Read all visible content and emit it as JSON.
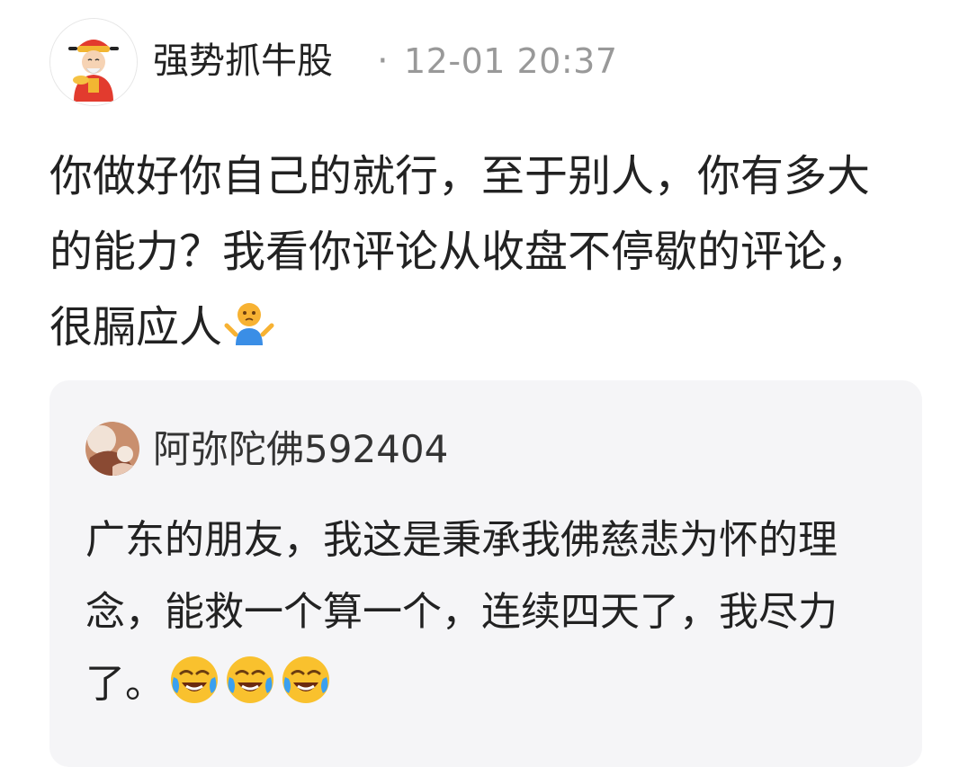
{
  "post": {
    "author": {
      "name": "强势抓牛股",
      "avatar_icon": "caishen-avatar-icon"
    },
    "separator": "·",
    "timestamp": "12-01 20:37",
    "content": "你做好你自己的就行，至于别人，你有多大的能力？我看你评论从收盘不停歇的评论，很膈应人",
    "content_emoji": "shrug-emoji-icon"
  },
  "quoted": {
    "author": {
      "name": "阿弥陀佛592404",
      "avatar_icon": "user-avatar-icon"
    },
    "content": "广东的朋友，我这是秉承我佛慈悲为怀的理念，能救一个算一个，连续四天了，我尽力了。",
    "content_emojis": [
      "laugh-cry-emoji-icon",
      "laugh-cry-emoji-icon",
      "laugh-cry-emoji-icon"
    ]
  },
  "colors": {
    "quote_background": "#f5f5f7",
    "timestamp": "#999999",
    "text": "#222222"
  }
}
